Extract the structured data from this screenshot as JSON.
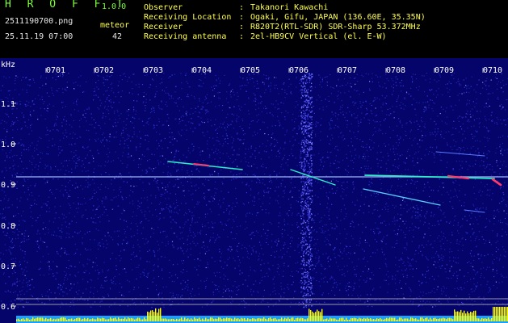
{
  "header": {
    "app_title": "H R O F F T",
    "app_version": "1.0.0",
    "file_name": "2511190700.png",
    "date_time": "25.11.19 07:00",
    "meteor_label": "meteor",
    "meteor_count": "42",
    "info": [
      {
        "label": "Observer",
        "value": "Takanori Kawachi"
      },
      {
        "label": "Receiving Location",
        "value": "Ogaki, Gifu, JAPAN (136.60E, 35.35N)"
      },
      {
        "label": "Receiver",
        "value": "R820T2(RTL-SDR) SDR-Sharp 53.372MHz"
      },
      {
        "label": "Receiving antenna",
        "value": "2el-HB9CV Vertical (el. E-W)"
      }
    ]
  },
  "spectrogram": {
    "unit_label": "kHz",
    "time_labels": [
      "0701",
      "0702",
      "0703",
      "0704",
      "0705",
      "0706",
      "0707",
      "0708",
      "0709",
      "0710"
    ],
    "freq_labels": [
      "1.1",
      "1.0",
      "0.9",
      "0.8",
      "0.7",
      "0.6"
    ],
    "colors": {
      "background": "#04046a",
      "noise": "#3a3adc",
      "carrier": "#9fb4ff",
      "echo": "#2af0c8",
      "bright_echo": "#ff3a6a",
      "signal_bar": "#ffff00",
      "signal_base": "#1aa0ff"
    }
  }
}
